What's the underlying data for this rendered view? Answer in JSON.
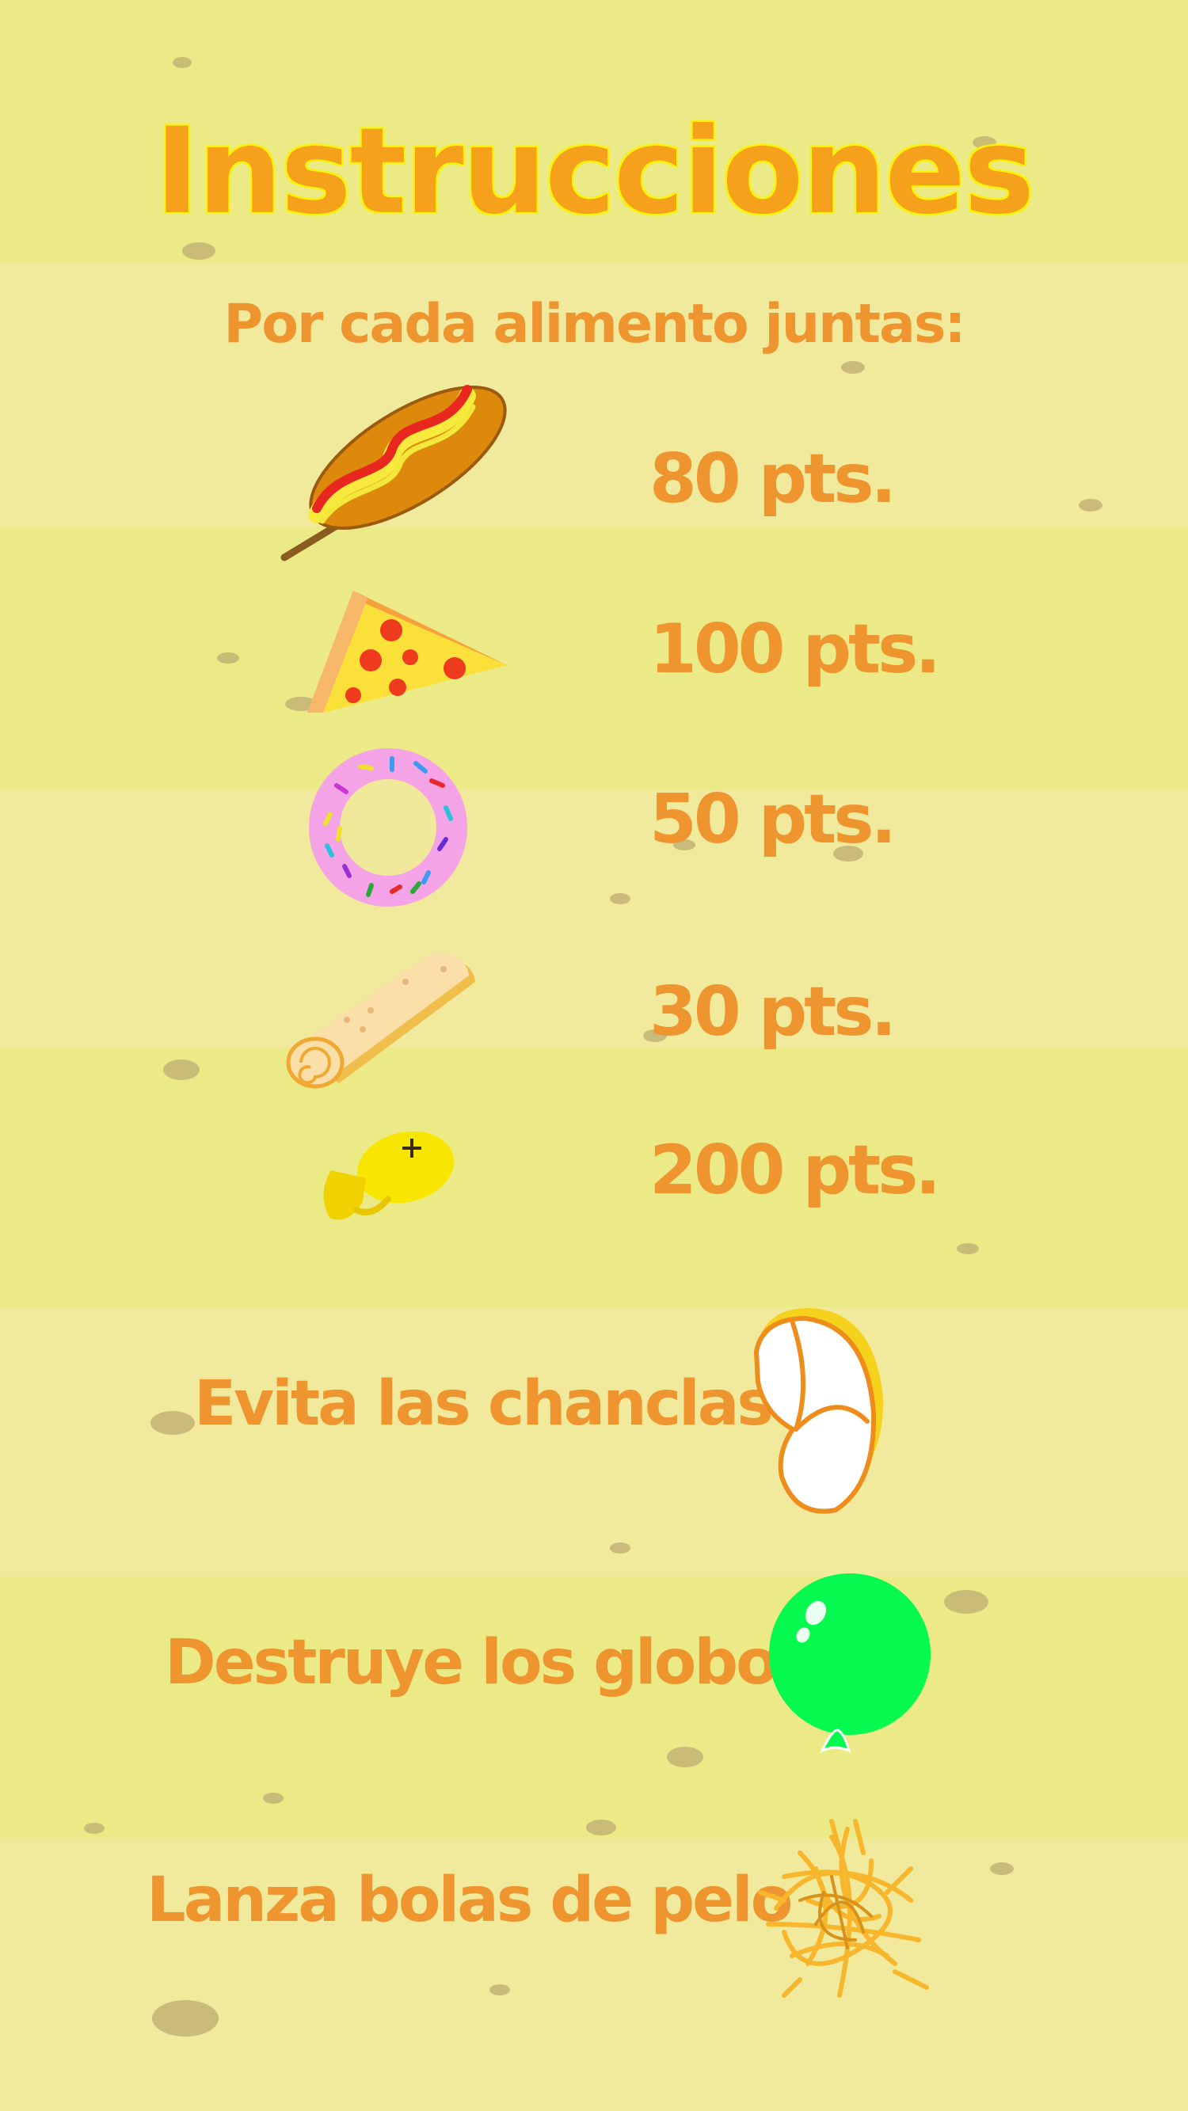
{
  "title": "Instrucciones",
  "subtitle": "Por cada alimento juntas:",
  "foods": [
    {
      "icon": "corndog-icon",
      "points": "80 pts."
    },
    {
      "icon": "pizza-slice-icon",
      "points": "100 pts."
    },
    {
      "icon": "donut-icon",
      "points": "50 pts."
    },
    {
      "icon": "burrito-icon",
      "points": "30 pts."
    },
    {
      "icon": "fish-icon",
      "points": "200 pts."
    }
  ],
  "rules": [
    {
      "text": "Evita las chanclas",
      "icon": "flip-flop-icon"
    },
    {
      "text": "Destruye los globos",
      "icon": "balloon-icon"
    },
    {
      "text": "Lanza bolas de pelo",
      "icon": "hairball-icon"
    }
  ],
  "colors": {
    "text": "#ee9530",
    "title": "#f6a11c",
    "balloon": "#05f94f",
    "background": "#ecea86"
  }
}
